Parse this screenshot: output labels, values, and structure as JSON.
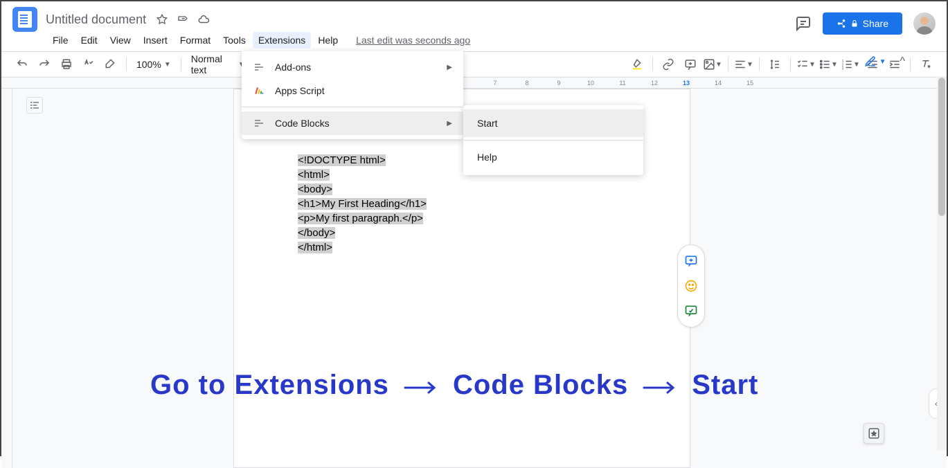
{
  "header": {
    "doc_title": "Untitled document",
    "last_edit": "Last edit was seconds ago",
    "share_label": "Share"
  },
  "menubar": {
    "items": [
      "File",
      "Edit",
      "View",
      "Insert",
      "Format",
      "Tools",
      "Extensions",
      "Help"
    ],
    "active_index": 6
  },
  "toolbar": {
    "zoom": "100%",
    "style": "Normal text"
  },
  "dropdown": {
    "items": [
      {
        "label": "Add-ons",
        "has_submenu": true,
        "icon": "addons"
      },
      {
        "label": "Apps Script",
        "has_submenu": false,
        "icon": "appsscript"
      }
    ],
    "highlighted": {
      "label": "Code Blocks",
      "icon": "codeblocks"
    }
  },
  "submenu": {
    "items": [
      "Start",
      "Help"
    ],
    "highlighted_index": 0
  },
  "document_content": {
    "lines": [
      "<!DOCTYPE html>",
      "<html>",
      "<body>",
      "",
      "<h1>My First Heading</h1>",
      "<p>My first paragraph.</p>",
      "",
      "</body>",
      "</html>"
    ]
  },
  "ruler": {
    "numbers": [
      "7",
      "8",
      "9",
      "10",
      "11",
      "12",
      "13",
      "14",
      "15"
    ]
  },
  "annotation": {
    "text_parts": [
      "Go to Extensions",
      "Code Blocks",
      "Start"
    ]
  }
}
